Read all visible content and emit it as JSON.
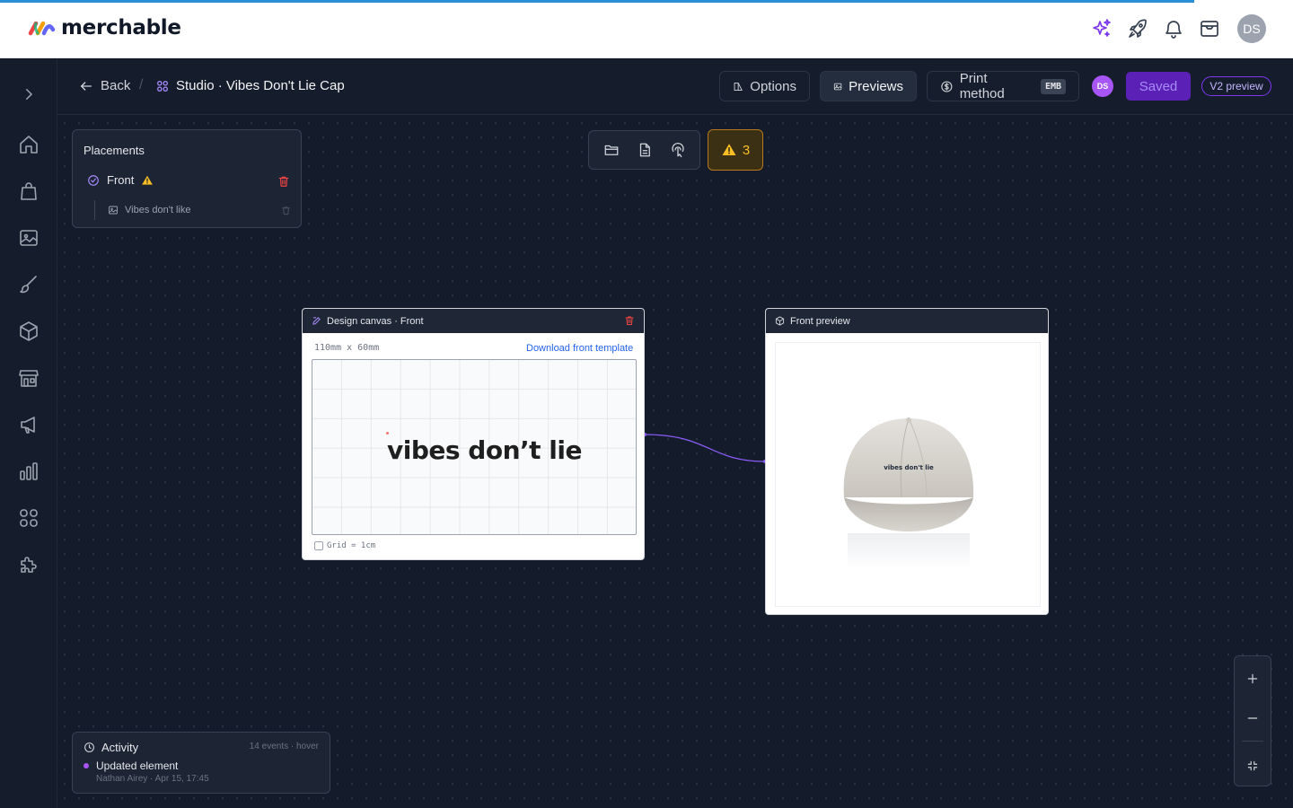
{
  "app": {
    "brand": "merchable",
    "user_initials": "DS"
  },
  "header": {
    "back_label": "Back",
    "separator": "/",
    "title": "Studio · Vibes Don't Lie Cap",
    "buttons": {
      "options": "Options",
      "previews": "Previews",
      "print_method": "Print method",
      "print_method_badge": "EMB"
    },
    "collab_initials": "DS",
    "saved_label": "Saved",
    "v2_label": "V2 preview"
  },
  "placements": {
    "title": "Placements",
    "items": [
      {
        "label": "Front",
        "warning": true,
        "children": [
          {
            "label": "Vibes don't like"
          }
        ]
      }
    ]
  },
  "toolbar": {
    "warning_count": "3"
  },
  "design_canvas": {
    "title": "Design canvas · Front",
    "dimensions": "110mm x 60mm",
    "download_label": "Download front template",
    "artwork_text": "vibes don’t lie",
    "grid_label": "Grid = 1cm"
  },
  "preview": {
    "title": "Front preview",
    "cap_text": "vibes don't lie"
  },
  "activity": {
    "title": "Activity",
    "meta": "14 events · hover",
    "event": "Updated element",
    "event_meta": "Nathan Airey · Apr 15, 17:45"
  },
  "colors": {
    "accent": "#7c3aed",
    "warning": "#fbbf24",
    "danger": "#ef4444",
    "link": "#2563eb",
    "progress": "#2b8fd6"
  }
}
